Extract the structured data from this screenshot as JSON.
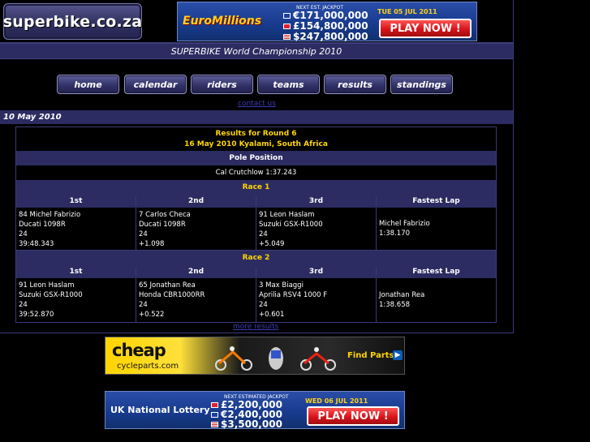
{
  "site": {
    "logo_text": "superbike.co.za"
  },
  "ads": {
    "euromillions": {
      "brand": "EuroMillions",
      "heading": "NEXT EST. JACKPOT",
      "date": "TUE 05 JUL 2011",
      "amounts": [
        "€171,000,000",
        "£154,800,000",
        "$247,800,000"
      ],
      "cta": "PLAY NOW !"
    },
    "cheap": {
      "brand": "cheap",
      "sub": "cycleparts.com",
      "cta": "Find Parts"
    },
    "uk_lottery": {
      "brand": "UK National Lottery",
      "heading": "NEXT ESTIMATED JACKPOT",
      "date": "WED 06 JUL 2011",
      "amounts": [
        "£2,200,000",
        "€2,400,000",
        "$3,500,000"
      ],
      "cta": "PLAY NOW !"
    }
  },
  "page_title": "SUPERBIKE World Championship 2010",
  "nav": [
    "home",
    "calendar",
    "riders",
    "teams",
    "results",
    "standings"
  ],
  "contact_link": "contact us",
  "date_bar": "10 May 2010",
  "results": {
    "round_title": "Results for Round 6",
    "round_sub": "16 May 2010 Kyalami, South Africa",
    "pole_label": "Pole Position",
    "pole_value": "Cal Crutchlow 1:37.243",
    "columns": [
      "1st",
      "2nd",
      "3rd",
      "Fastest Lap"
    ],
    "races": [
      {
        "label": "Race 1",
        "places": [
          [
            "84 Michel Fabrizio",
            "Ducati 1098R",
            "24",
            "39:48.343"
          ],
          [
            "7 Carlos Checa",
            "Ducati 1098R",
            "24",
            "+1.098"
          ],
          [
            "91 Leon Haslam",
            "Suzuki GSX-R1000",
            "24",
            "+5.049"
          ]
        ],
        "fastest": [
          "Michel Fabrizio",
          "1:38.170"
        ]
      },
      {
        "label": "Race 2",
        "places": [
          [
            "91 Leon Haslam",
            "Suzuki GSX-R1000",
            "24",
            "39:52.870"
          ],
          [
            "65 Jonathan Rea",
            "Honda CBR1000RR",
            "24",
            "+0.522"
          ],
          [
            "3 Max Biaggi",
            "Aprilia RSV4 1000 F",
            "24",
            "+0.601"
          ]
        ],
        "fastest": [
          "Jonathan Rea",
          "1:38.658"
        ]
      }
    ],
    "more_link": "more results"
  }
}
